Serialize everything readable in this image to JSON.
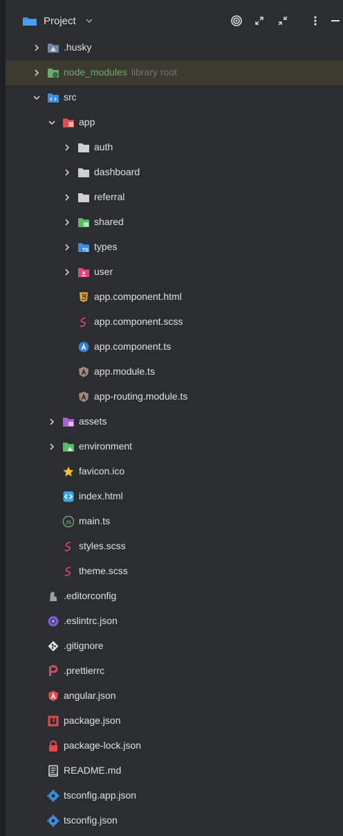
{
  "header": {
    "title": "Project",
    "icons": [
      "folder-icon",
      "chevron-down-icon",
      "target-icon",
      "expand-icon",
      "collapse-icon",
      "more-vertical-icon",
      "minimize-icon"
    ]
  },
  "tree": [
    {
      "label": "node_modules",
      "hint": "library root"
    },
    {
      "label": ".husky"
    },
    {
      "label": "src"
    },
    {
      "label": "app"
    },
    {
      "label": "auth"
    },
    {
      "label": "dashboard"
    },
    {
      "label": "referral"
    },
    {
      "label": "shared"
    },
    {
      "label": "types"
    },
    {
      "label": "user"
    },
    {
      "label": "app.component.html"
    },
    {
      "label": "app.component.scss"
    },
    {
      "label": "app.component.ts"
    },
    {
      "label": "app.module.ts"
    },
    {
      "label": "app-routing.module.ts"
    },
    {
      "label": "assets"
    },
    {
      "label": "environment"
    },
    {
      "label": "favicon.ico"
    },
    {
      "label": "index.html"
    },
    {
      "label": "main.ts"
    },
    {
      "label": "styles.scss"
    },
    {
      "label": "theme.scss"
    },
    {
      "label": ".editorconfig"
    },
    {
      "label": ".eslintrc.json"
    },
    {
      "label": ".gitignore"
    },
    {
      "label": ".prettierrc"
    },
    {
      "label": "angular.json"
    },
    {
      "label": "package.json"
    },
    {
      "label": "package-lock.json"
    },
    {
      "label": "README.md"
    },
    {
      "label": "tsconfig.app.json"
    },
    {
      "label": "tsconfig.json"
    }
  ],
  "colors": {
    "background": "#2b2d30",
    "text": "#dfe1e5",
    "library_root_text": "#6aab73",
    "hint_text": "#6f737a",
    "library_row_bg": "#3d3a30"
  }
}
